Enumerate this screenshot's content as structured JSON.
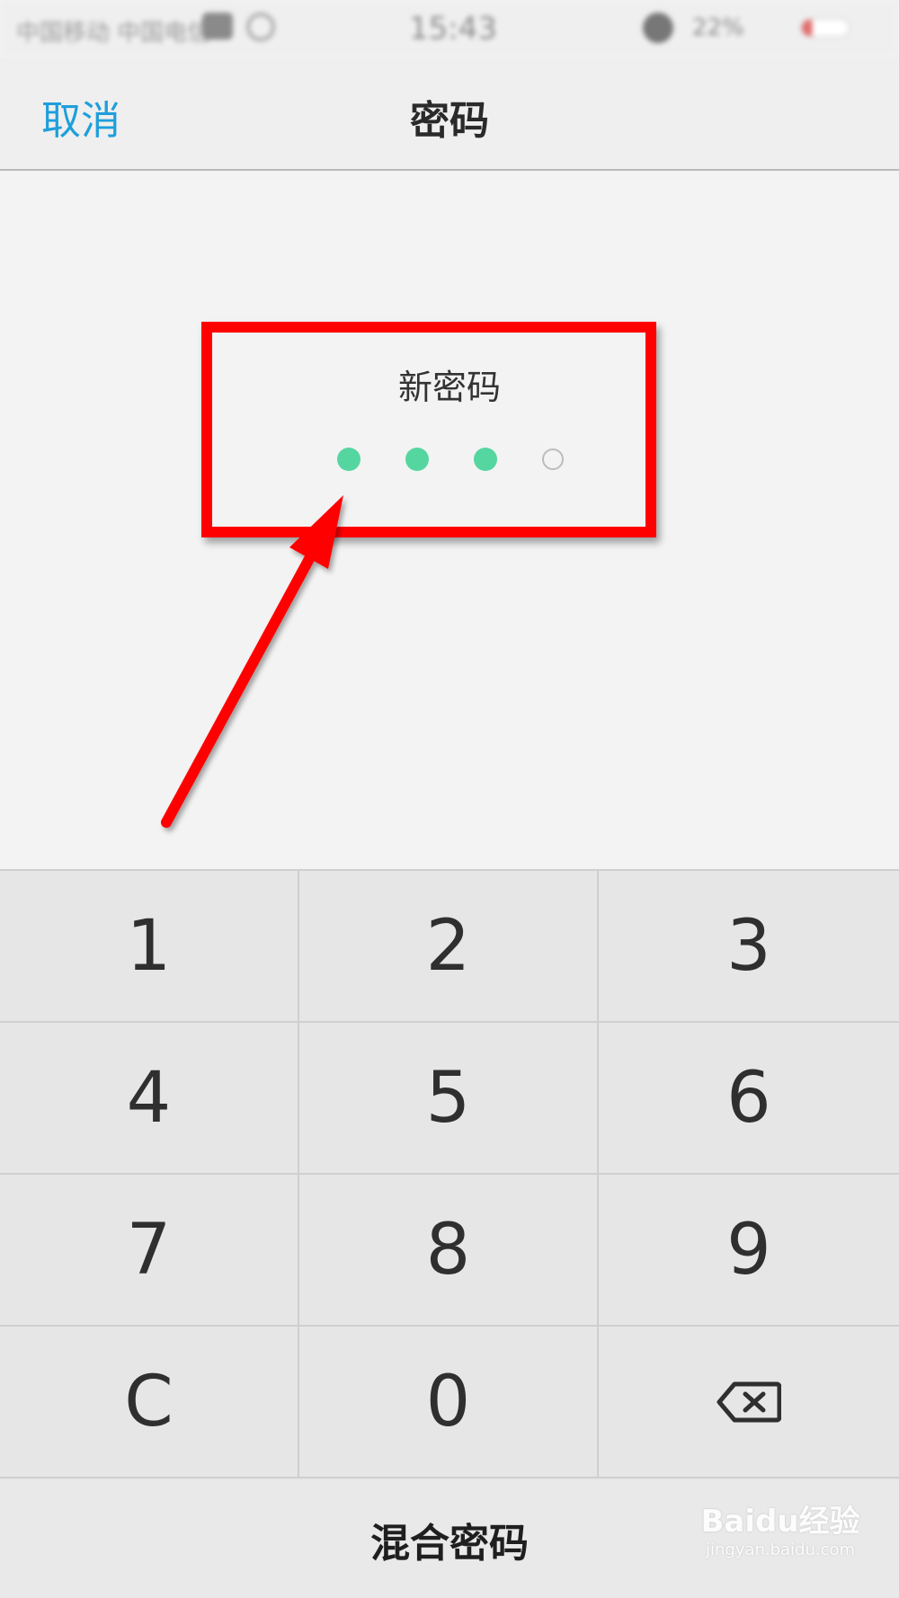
{
  "status_bar": {
    "carrier": "中国移动 中国电信",
    "time": "15:43",
    "battery": "22%"
  },
  "nav": {
    "cancel_label": "取消",
    "title": "密码"
  },
  "prompt": {
    "label": "新密码",
    "pin_length": 4,
    "digits_entered": 3
  },
  "keypad": {
    "keys": [
      "1",
      "2",
      "3",
      "4",
      "5",
      "6",
      "7",
      "8",
      "9",
      "C",
      "0"
    ]
  },
  "bottom": {
    "mixed_password_label": "混合密码"
  },
  "watermark": {
    "brand": "Baidu经验",
    "url": "jingyan.baidu.com"
  },
  "colors": {
    "accent_blue": "#1e9fdb",
    "pin_filled": "#55d6a0",
    "annotation_red": "#ff0000"
  }
}
